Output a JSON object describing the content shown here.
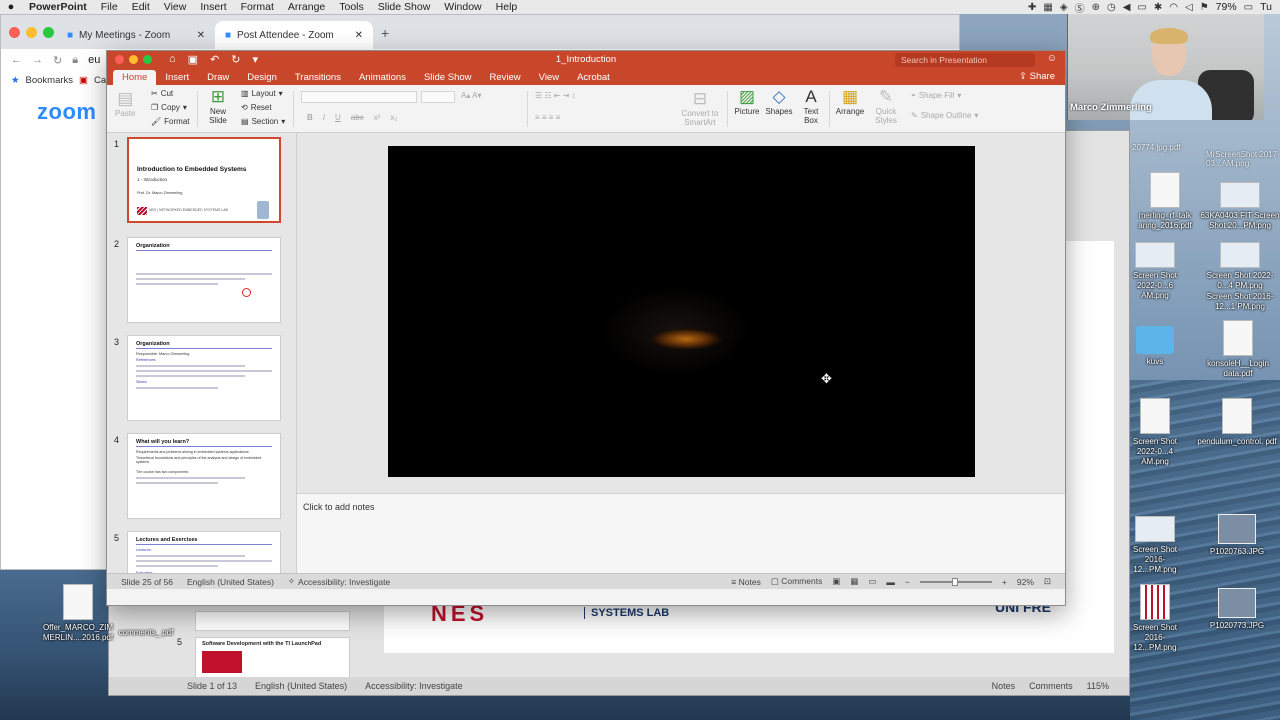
{
  "menubar": {
    "apple": "",
    "app": "PowerPoint",
    "items": [
      "File",
      "Edit",
      "View",
      "Insert",
      "Format",
      "Arrange",
      "Tools",
      "Slide Show",
      "Window",
      "Help"
    ],
    "battery": "79%",
    "clock": "Tu"
  },
  "chrome": {
    "tab1": "My Meetings - Zoom",
    "tab2": "Post Attendee - Zoom",
    "address": "eu",
    "bookmarks": "Bookmarks",
    "bookmark2": "Ca",
    "logo": "zoom"
  },
  "ppt": {
    "doc_title": "1_Introduction",
    "search_placeholder": "Search in Presentation",
    "share": "Share",
    "tabs": [
      "Home",
      "Insert",
      "Draw",
      "Design",
      "Transitions",
      "Animations",
      "Slide Show",
      "Review",
      "View",
      "Acrobat"
    ],
    "ribbon": {
      "paste": "Paste",
      "cut": "Cut",
      "copy": "Copy",
      "format": "Format",
      "new_slide": "New Slide",
      "layout": "Layout",
      "reset": "Reset",
      "section": "Section",
      "convert": "Convert to SmartArt",
      "picture": "Picture",
      "shapes": "Shapes",
      "textbox": "Text Box",
      "arrange": "Arrange",
      "quick_styles": "Quick Styles",
      "shape_fill": "Shape Fill",
      "shape_outline": "Shape Outline"
    },
    "thumbnails": [
      {
        "num": "1",
        "title": "Introduction to Embedded Systems",
        "sub": "1 - Introduction",
        "author": "Prof. Dr. Marco Zimmerling",
        "logo": "NES | NETWORKED EMBEDDED SYSTEMS LAB"
      },
      {
        "num": "2",
        "title": "Organization"
      },
      {
        "num": "3",
        "title": "Organization",
        "lines": [
          "Responsible: Marco Zimmerling",
          "References:",
          "Slides:"
        ]
      },
      {
        "num": "4",
        "title": "What will you learn?",
        "lines": [
          "Requirements and problems arising in embedded systems applications",
          "Theoretical foundations and principles of the analysis and design of embedded systems",
          "The course has two components:"
        ]
      },
      {
        "num": "5",
        "title": "Lectures and Exercises",
        "lines": [
          "Lectures:",
          "Exercises:"
        ]
      }
    ],
    "notes_placeholder": "Click to add notes",
    "status": {
      "slide": "Slide 25 of 56",
      "language": "English (United States)",
      "accessibility": "Accessibility: Investigate",
      "notes": "Notes",
      "comments": "Comments",
      "zoom": "92%"
    }
  },
  "ppt_behind": {
    "lab_logo": "NES",
    "lab_text": "SYSTEMS LAB",
    "uni": "UNI FRE",
    "thumb5_num": "5",
    "thumb5_title": "Software Development with the TI LaunchPad",
    "status": {
      "slide": "Slide 1 of 13",
      "language": "English (United States)",
      "accessibility": "Accessibility: Investigate",
      "notes": "Notes",
      "comments": "Comments",
      "zoom": "115%"
    }
  },
  "video": {
    "name": "Marco Zimmerling"
  },
  "desktop_icons": [
    {
      "label": "Offer_MARCO_ZIM MERLIN....2016.pdf"
    },
    {
      "label": "comments_ pdf"
    },
    {
      "label": "merling_rf_talk aring_2016.pdf"
    },
    {
      "label": "63KA0403.FIT Screen Shot 20...PM.png"
    },
    {
      "label": "Screen Shot 2022-0...6 AM.png"
    },
    {
      "label": "Screen Shot 2022-0...4 PM.png"
    },
    {
      "label": "Screen Shot 2016-12...1 PM.png"
    },
    {
      "label": "kuvs"
    },
    {
      "label": "konsoleH__Login data.pdf"
    },
    {
      "label": "Screen Shot 2022-0...4 AM.png"
    },
    {
      "label": "pendulum_control. pdf"
    },
    {
      "label": "Screen Shot 2016-12...PM.png"
    },
    {
      "label": "P1020763.JPG"
    },
    {
      "label": "Screen Shot 2016-12...PM.png"
    },
    {
      "label": "P1020773.JPG"
    },
    {
      "label": "20774.jpg.pdf"
    },
    {
      "label": "MrScreenShot 2017-03...AM.png"
    }
  ]
}
